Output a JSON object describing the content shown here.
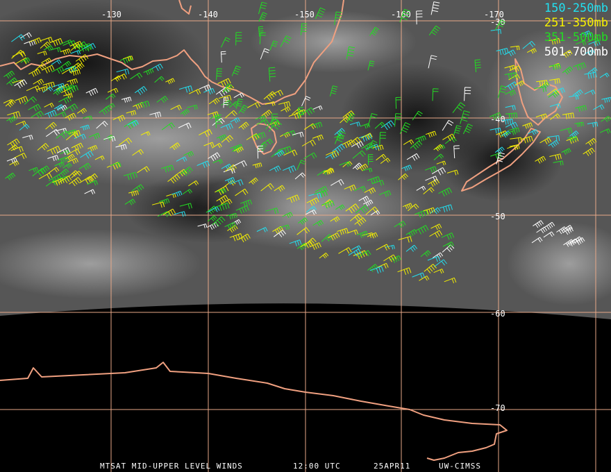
{
  "map": {
    "longitude_labels": [
      "-130",
      "-140",
      "-150",
      "-160",
      "-170"
    ],
    "latitude_labels": [
      "-30",
      "-40",
      "-50",
      "-60",
      "-70"
    ]
  },
  "legend": {
    "items": [
      {
        "label": "150-250mb",
        "color": "#22e0f0"
      },
      {
        "label": "251-350mb",
        "color": "#f5f000"
      },
      {
        "label": "351-500mb",
        "color": "#22dd22"
      },
      {
        "label": "501-700mb",
        "color": "#ffffff"
      }
    ]
  },
  "footer": {
    "title": "MTSAT MID-UPPER LEVEL WINDS",
    "time": "12:00 UTC",
    "date": "25APR11",
    "credit": "UW-CIMSS"
  },
  "colors": {
    "coastline": "#f0a080",
    "gridlines": "#e8a888",
    "night_side": "#000000"
  }
}
